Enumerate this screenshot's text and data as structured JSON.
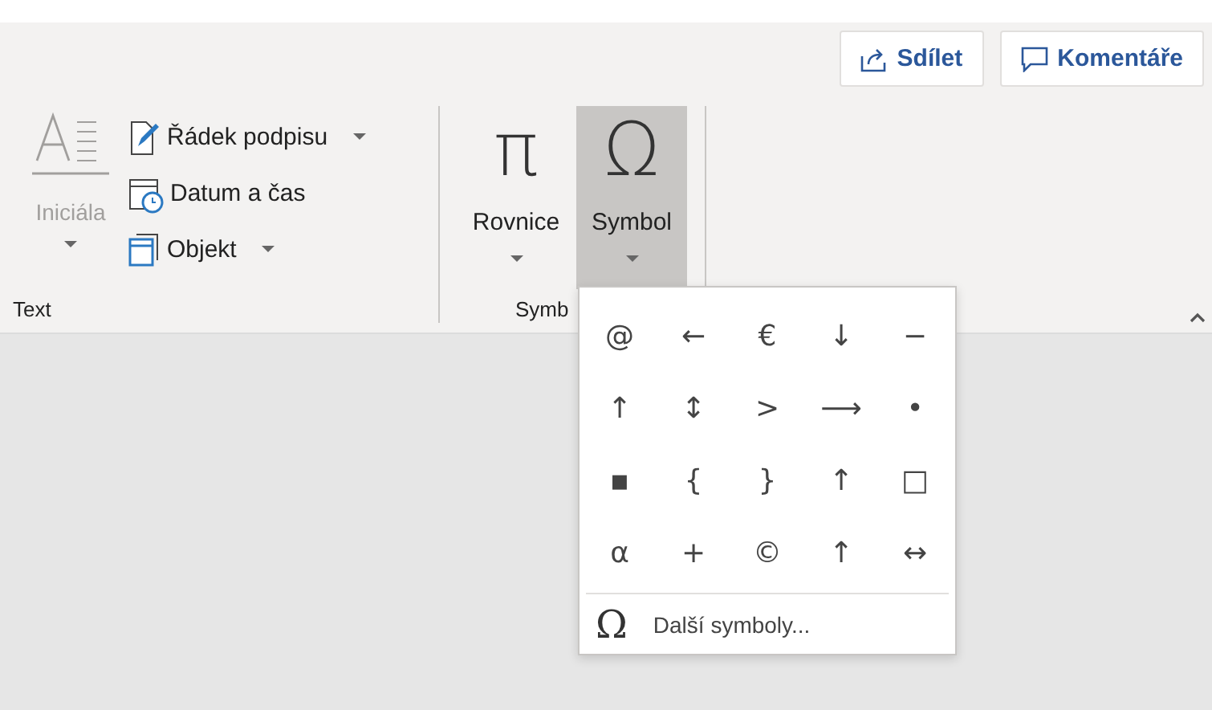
{
  "header_buttons": [
    {
      "kind": "share",
      "label": "Sdílet"
    },
    {
      "kind": "comment",
      "label": "Komentáře"
    }
  ],
  "text_group": {
    "label": "Text",
    "drop_cap": {
      "label": "Iniciála",
      "disabled": true
    },
    "items": [
      {
        "kind": "signature",
        "label": "Řádek podpisu",
        "has_menu": true
      },
      {
        "kind": "datetime",
        "label": "Datum a čas",
        "has_menu": false
      },
      {
        "kind": "object",
        "label": "Objekt",
        "has_menu": true
      }
    ]
  },
  "symbols_group": {
    "label": "Symb",
    "buttons": [
      {
        "glyph": "π",
        "label": "Rovnice",
        "selected": false
      },
      {
        "glyph": "Ω",
        "label": "Symbol",
        "selected": true
      }
    ]
  },
  "symbol_menu": {
    "symbols": [
      "@",
      "←",
      "€",
      "↓",
      "−",
      "↑",
      "↕",
      ">",
      "⟶",
      "•",
      "▪",
      "{",
      "}",
      "↑",
      "□",
      "α",
      "+",
      "©",
      "↑",
      "↔"
    ],
    "more": {
      "glyph": "Ω",
      "label": "Další symboly..."
    }
  }
}
